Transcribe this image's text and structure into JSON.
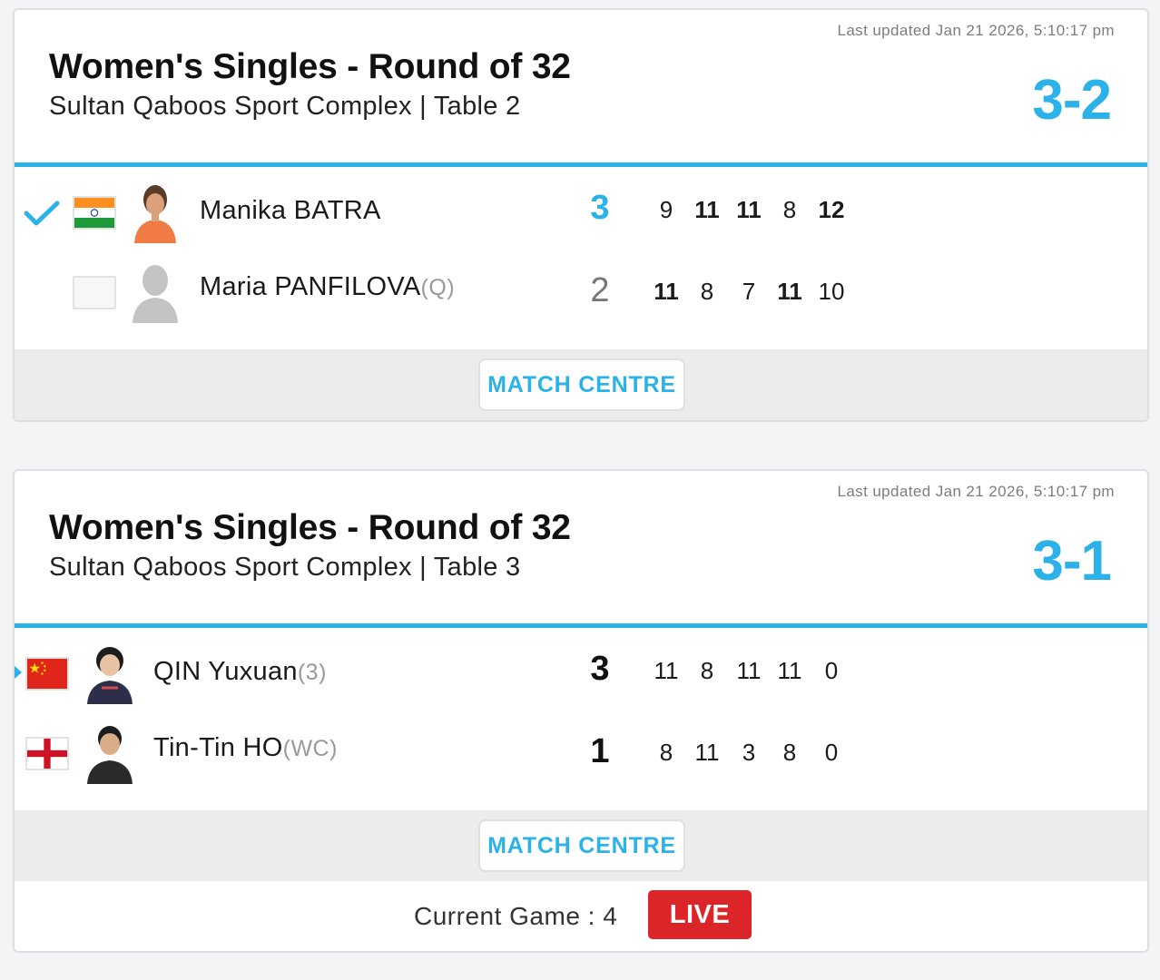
{
  "matches": [
    {
      "last_updated": "Last updated Jan 21 2026, 5:10:17 pm",
      "title": "Women's Singles - Round of 32",
      "venue": "Sultan Qaboos Sport Complex | Table 2",
      "match_score": "3-2",
      "players": [
        {
          "name": "Manika BATRA",
          "seed": "",
          "country": "India",
          "flag_icon": "india-flag-icon",
          "games_won": "3",
          "winner": true,
          "points": [
            "9",
            "11",
            "11",
            "8",
            "12"
          ]
        },
        {
          "name": "Maria PANFILOVA",
          "seed": "(Q)",
          "country": "",
          "flag_icon": "",
          "games_won": "2",
          "winner": false,
          "points": [
            "11",
            "8",
            "7",
            "11",
            "10"
          ]
        }
      ],
      "match_centre_label": "MATCH CENTRE"
    },
    {
      "last_updated": "Last updated Jan 21 2026, 5:10:17 pm",
      "title": "Women's Singles - Round of 32",
      "venue": "Sultan Qaboos Sport Complex | Table 3",
      "match_score": "3-1",
      "players": [
        {
          "name": "QIN Yuxuan",
          "seed": "(3)",
          "country": "China",
          "flag_icon": "china-flag-icon",
          "games_won": "3",
          "serving": true,
          "points": [
            "11",
            "8",
            "11",
            "11",
            "0"
          ]
        },
        {
          "name": "Tin-Tin HO",
          "seed": "(WC)",
          "country": "England",
          "flag_icon": "england-flag-icon",
          "games_won": "1",
          "points": [
            "8",
            "11",
            "3",
            "8",
            "0"
          ]
        }
      ],
      "match_centre_label": "MATCH CENTRE",
      "current_game": "Current Game : 4",
      "live_label": "LIVE"
    }
  ],
  "colors": {
    "accent": "#2bb2e8",
    "live": "#dc2528",
    "footer_band": "#ececec"
  }
}
